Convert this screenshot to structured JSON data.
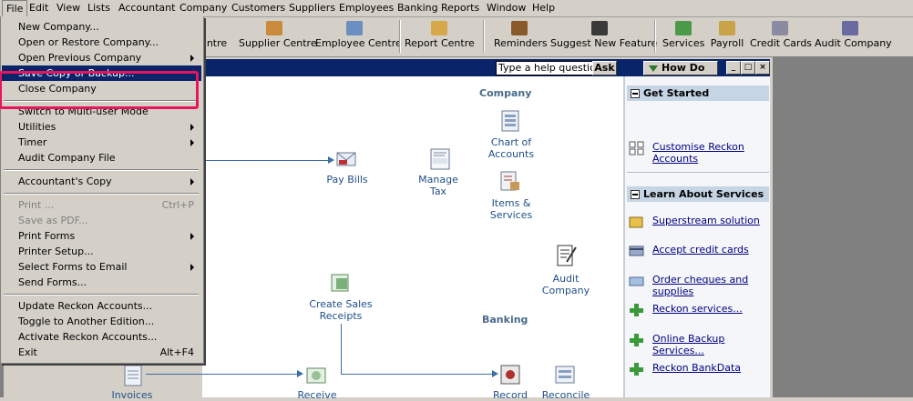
{
  "menubar": [
    "File",
    "Edit",
    "View",
    "Lists",
    "Accountant",
    "Company",
    "Customers",
    "Suppliers",
    "Employees",
    "Banking",
    "Reports",
    "Window",
    "Help"
  ],
  "toolbar": {
    "items": [
      "ntre",
      "Supplier Centre",
      "Employee Centre",
      "Report Centre",
      "Reminders",
      "Suggest New Feature",
      "Services",
      "Payroll",
      "Credit Cards",
      "Audit Company"
    ],
    "colors": [
      "#d6a84a",
      "#c98a3c",
      "#6a8fc0",
      "#d6a84a",
      "#8a5a2a",
      "#3a3a3a",
      "#4a9a4a",
      "#c9a24a",
      "#8a8aa0",
      "#6a6aa0"
    ]
  },
  "help": {
    "placeholder": "Type a help question",
    "ask": "Ask",
    "how_do_i": "How Do I?"
  },
  "file_menu": {
    "items": [
      {
        "label": "New Company...",
        "shortcut": "",
        "submenu": false,
        "disabled": false
      },
      {
        "label": "Open or Restore Company...",
        "shortcut": "",
        "submenu": false,
        "disabled": false
      },
      {
        "label": "Open Previous Company",
        "shortcut": "",
        "submenu": true,
        "disabled": false
      },
      {
        "label": "Save Copy or Backup...",
        "shortcut": "",
        "submenu": false,
        "disabled": false,
        "highlighted": true
      },
      {
        "label": "Close Company",
        "shortcut": "",
        "submenu": false,
        "disabled": false
      },
      {
        "label": "Switch to Multi-user Mode",
        "shortcut": "",
        "submenu": false,
        "disabled": false
      },
      {
        "label": "Utilities",
        "shortcut": "",
        "submenu": true,
        "disabled": false
      },
      {
        "label": "Timer",
        "shortcut": "",
        "submenu": true,
        "disabled": false
      },
      {
        "label": "Audit Company File",
        "shortcut": "",
        "submenu": false,
        "disabled": false
      },
      {
        "label": "Accountant's Copy",
        "shortcut": "",
        "submenu": true,
        "disabled": false
      },
      {
        "label": "Print ...",
        "shortcut": "Ctrl+P",
        "submenu": false,
        "disabled": true
      },
      {
        "label": "Save as PDF...",
        "shortcut": "",
        "submenu": false,
        "disabled": true
      },
      {
        "label": "Print Forms",
        "shortcut": "",
        "submenu": true,
        "disabled": false
      },
      {
        "label": "Printer Setup...",
        "shortcut": "",
        "submenu": false,
        "disabled": false
      },
      {
        "label": "Select Forms to Email",
        "shortcut": "",
        "submenu": true,
        "disabled": false
      },
      {
        "label": "Send Forms...",
        "shortcut": "",
        "submenu": false,
        "disabled": false
      },
      {
        "label": "Update Reckon Accounts...",
        "shortcut": "",
        "submenu": false,
        "disabled": false
      },
      {
        "label": "Toggle to Another Edition...",
        "shortcut": "",
        "submenu": false,
        "disabled": false
      },
      {
        "label": "Activate Reckon Accounts...",
        "shortcut": "",
        "submenu": false,
        "disabled": false
      },
      {
        "label": "Exit",
        "shortcut": "Alt+F4",
        "submenu": false,
        "disabled": false
      }
    ]
  },
  "home": {
    "sections": {
      "company": "Company",
      "banking": "Banking"
    },
    "items": {
      "pay_bills": "Pay Bills",
      "manage_tax": "Manage\nTax",
      "chart_of_accounts": "Chart of\nAccounts",
      "items_services": "Items &\nServices",
      "audit_company": "Audit\nCompany",
      "create_sales_receipts": "Create Sales\nReceipts",
      "invoices": "Invoices",
      "receive": "Receive",
      "record": "Record",
      "reconcile": "Reconcile"
    }
  },
  "sidebar": {
    "get_started": {
      "title": "Get Started",
      "links": [
        "Customise Reckon\nAccounts"
      ]
    },
    "learn": {
      "title": "Learn About Services",
      "links": [
        "Superstream solution",
        "Accept credit cards",
        "Order cheques and\nsupplies",
        "Reckon services...",
        "Online Backup Services...",
        "Reckon BankData"
      ]
    }
  },
  "accent": {
    "title_bar": "#0a246a",
    "menu_highlight": "#0a246a",
    "annotation": "#e8145c",
    "flow_line": "#3b6ea5"
  }
}
